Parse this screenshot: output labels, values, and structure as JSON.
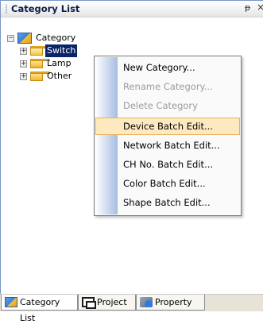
{
  "window": {
    "title": "Category List",
    "pin_glyph": "ᵽ",
    "close_glyph": "×"
  },
  "tree": {
    "root": {
      "label": "Category",
      "expander": "−"
    },
    "children": [
      {
        "label": "Switch",
        "expander": "+",
        "selected": true
      },
      {
        "label": "Lamp",
        "expander": "+"
      },
      {
        "label": "Other",
        "expander": "+"
      }
    ]
  },
  "context_menu": {
    "items": [
      {
        "label": "New Category...",
        "enabled": true
      },
      {
        "label": "Rename Category...",
        "enabled": false
      },
      {
        "label": "Delete Category",
        "enabled": false
      },
      {
        "label": "Device Batch Edit...",
        "enabled": true,
        "highlighted": true
      },
      {
        "label": "Network Batch Edit...",
        "enabled": true
      },
      {
        "label": "CH No. Batch Edit...",
        "enabled": true
      },
      {
        "label": "Color Batch Edit...",
        "enabled": true
      },
      {
        "label": "Shape Batch Edit...",
        "enabled": true
      }
    ]
  },
  "bottom_tabs": [
    {
      "label": "Category List",
      "icon": "category-list-icon",
      "active": true
    },
    {
      "label": "Project",
      "icon": "project-icon",
      "active": false
    },
    {
      "label": "Property",
      "icon": "property-icon",
      "active": false
    }
  ]
}
